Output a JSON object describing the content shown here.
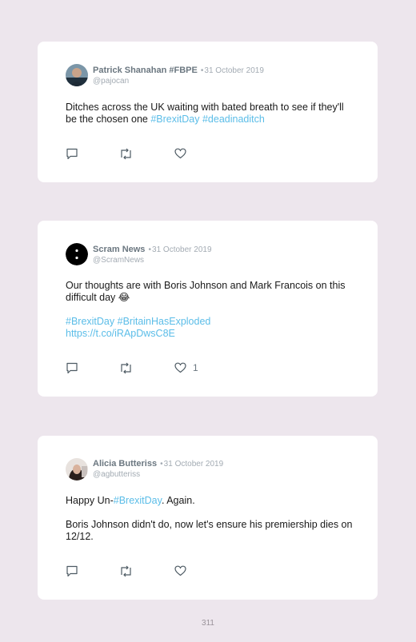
{
  "tweets": [
    {
      "name": "Patrick Shanahan #FBPE",
      "separator": "•",
      "date": "31 October 2019",
      "handle": "@pajocan",
      "text_before": "Ditches across the UK waiting with bated breath to see if they'll be the chosen one ",
      "hashtags": [
        "#BrexitDay",
        "#deadinaditch"
      ],
      "like_count": ""
    },
    {
      "name": "Scram News",
      "separator": "•",
      "date": "31 October 2019",
      "handle": "@ScramNews",
      "text_line1": "Our thoughts are with Boris Johnson and Mark Francois on this difficult day 😂",
      "hashtags": [
        "#BrexitDay",
        "#BritainHasExploded"
      ],
      "link": "https://t.co/iRApDwsC8E",
      "like_count": "1"
    },
    {
      "name": "Alicia Butteriss",
      "separator": "•",
      "date": "31 October 2019",
      "handle": "@agbutteriss",
      "text_pre": "Happy Un-",
      "hashtag": "#BrexitDay",
      "text_post": ". Again.",
      "text_para2": "Boris Johnson didn't do, now let's ensure his premiership dies on 12/12.",
      "like_count": ""
    }
  ],
  "icons": {
    "reply": "reply-icon",
    "retweet": "retweet-icon",
    "like": "heart-icon"
  },
  "colors": {
    "background": "#ede6ed",
    "card": "#ffffff",
    "hashtag": "#5bbde8",
    "name": "#6b7780",
    "meta": "#a3abb3"
  },
  "page_number": "311"
}
